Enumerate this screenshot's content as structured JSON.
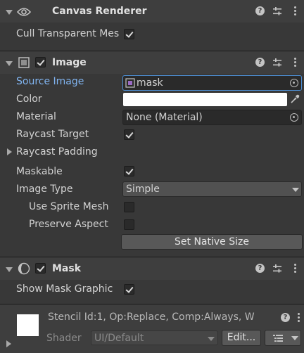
{
  "canvas_renderer": {
    "title": "Canvas Renderer",
    "cull_transparent_label": "Cull Transparent Mes",
    "cull_transparent_checked": true
  },
  "image": {
    "title": "Image",
    "enabled": true,
    "source_image_label": "Source Image",
    "source_image_value": "mask",
    "color_label": "Color",
    "color_value": "#ffffff",
    "material_label": "Material",
    "material_value": "None (Material)",
    "raycast_target_label": "Raycast Target",
    "raycast_target_checked": true,
    "raycast_padding_label": "Raycast Padding",
    "maskable_label": "Maskable",
    "maskable_checked": true,
    "image_type_label": "Image Type",
    "image_type_value": "Simple",
    "use_sprite_mesh_label": "Use Sprite Mesh",
    "use_sprite_mesh_checked": false,
    "preserve_aspect_label": "Preserve Aspect",
    "preserve_aspect_checked": false,
    "set_native_size_label": "Set Native Size"
  },
  "mask": {
    "title": "Mask",
    "enabled": true,
    "show_mask_graphic_label": "Show Mask Graphic",
    "show_mask_graphic_checked": true
  },
  "material_preview": {
    "stencil_text": "Stencil Id:1, Op:Replace, Comp:Always, W",
    "shader_label": "Shader",
    "shader_value": "UI/Default",
    "edit_label": "Edit..."
  },
  "icons": {
    "help": "help-icon",
    "presets": "presets-icon",
    "menu": "kebab-menu-icon",
    "eye": "eye-icon",
    "image": "image-component-icon",
    "mask": "mask-component-icon",
    "target": "object-picker-icon",
    "eyedropper": "eyedropper-icon"
  }
}
